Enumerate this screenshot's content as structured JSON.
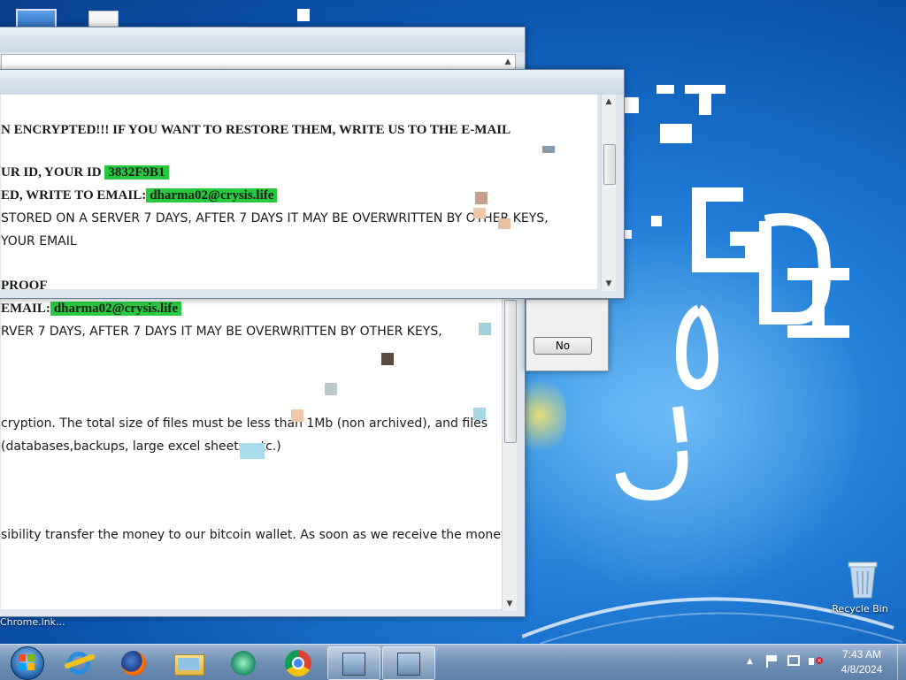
{
  "desktop": {
    "recycle_bin_label": "Recycle Bin",
    "chrome_shortcut_label": "Chrome.lnk..."
  },
  "graffiti": {
    "text": "GDI"
  },
  "ransom_note_front": {
    "lines": [
      {
        "text": "N ENCRYPTED!!! IF YOU WANT TO RESTORE THEM, WRITE US TO THE E-MAIL",
        "bold": true
      },
      {
        "text": "UR ID, YOUR ID ",
        "bold": true,
        "highlight": "3832F9B1"
      },
      {
        "text": "ED, WRITE TO EMAIL:",
        "bold": true,
        "highlight": "dharma02@crysis.life"
      },
      {
        "text": "STORED ON A SERVER 7 DAYS, AFTER 7 DAYS IT MAY BE OVERWRITTEN BY OTHER KEYS,",
        "bold": false
      },
      {
        "text": " YOUR EMAIL",
        "bold": false
      },
      {
        "text": " PROOF",
        "bold": true
      }
    ]
  },
  "ransom_note_back": {
    "lines": [
      {
        "text": "EMAIL:",
        "bold": true,
        "highlight": "dharma02@crysis.life"
      },
      {
        "text": "RVER 7 DAYS, AFTER 7 DAYS IT MAY BE OVERWRITTEN BY OTHER KEYS,",
        "bold": false
      },
      {
        "text": "cryption. The total size of files must be less than 1Mb (non archived), and files",
        "bold": false
      },
      {
        "text": "(databases,backups, large excel sheets, etc.)",
        "bold": false
      },
      {
        "text": "sibility transfer the money to our bitcoin wallet. As soon as we receive the money we",
        "bold": false
      }
    ]
  },
  "dialog": {
    "no_button": "No"
  },
  "taskbar": {
    "pinned": [
      "start-orb",
      "internet-explorer-icon",
      "firefox-icon",
      "file-explorer-icon",
      "media-player-icon",
      "chrome-icon",
      "app-window-icon",
      "app-window-icon"
    ],
    "time": "7:43 AM",
    "date": "4/8/2024"
  },
  "colors": {
    "highlight": "#27c93f",
    "desktop_blue": "#1f7bd6"
  }
}
